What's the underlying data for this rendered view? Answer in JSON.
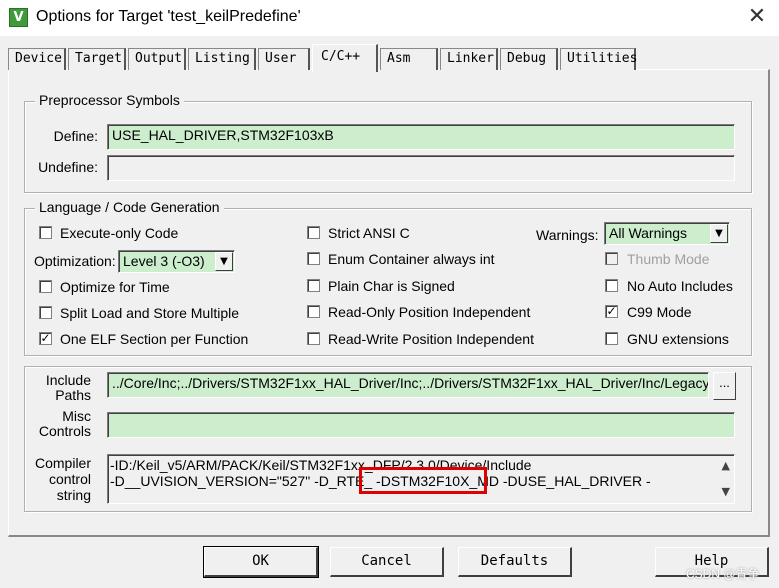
{
  "window": {
    "title": "Options for Target 'test_keilPredefine'",
    "icon": "keil-app-icon",
    "icon_glyph": "V",
    "close_glyph": "✕"
  },
  "tabs": [
    {
      "label": "Device"
    },
    {
      "label": "Target"
    },
    {
      "label": "Output"
    },
    {
      "label": "Listing"
    },
    {
      "label": "User"
    },
    {
      "label": "C/C++"
    },
    {
      "label": "Asm"
    },
    {
      "label": "Linker"
    },
    {
      "label": "Debug"
    },
    {
      "label": "Utilities"
    }
  ],
  "active_tab": "C/C++",
  "preprocessor": {
    "title": "Preprocessor Symbols",
    "define_label": "Define:",
    "define_value": "USE_HAL_DRIVER,STM32F103xB",
    "undefine_label": "Undefine:",
    "undefine_value": ""
  },
  "codegen": {
    "title": "Language / Code Generation",
    "execute_only": {
      "label": "Execute-only Code",
      "checked": false,
      "mark": ""
    },
    "optimization_label": "Optimization:",
    "optimization_value": "Level 3 (-O3)",
    "optimize_time": {
      "label": "Optimize for Time",
      "checked": false,
      "mark": ""
    },
    "split_load": {
      "label": "Split Load and Store Multiple",
      "checked": false,
      "mark": ""
    },
    "one_elf": {
      "label": "One ELF Section per Function",
      "checked": true,
      "mark": "✓"
    },
    "strict_ansi": {
      "label": "Strict ANSI C",
      "checked": false,
      "mark": ""
    },
    "enum_int": {
      "label": "Enum Container always int",
      "checked": false,
      "mark": ""
    },
    "plain_char": {
      "label": "Plain Char is Signed",
      "checked": false,
      "mark": ""
    },
    "ro_pi": {
      "label": "Read-Only Position Independent",
      "checked": false,
      "mark": ""
    },
    "rw_pi": {
      "label": "Read-Write Position Independent",
      "checked": false,
      "mark": ""
    },
    "warnings_label": "Warnings:",
    "warnings_value": "All Warnings",
    "thumb_mode": {
      "label": "Thumb Mode",
      "checked": false,
      "mark": "",
      "disabled": true
    },
    "no_auto_includes": {
      "label": "No Auto Includes",
      "checked": false,
      "mark": ""
    },
    "c99_mode": {
      "label": "C99 Mode",
      "checked": true,
      "mark": "✓"
    },
    "gnu_ext": {
      "label": "GNU extensions",
      "checked": false,
      "mark": ""
    }
  },
  "misc": {
    "include_label_1": "Include",
    "include_label_2": "Paths",
    "include_value": "../Core/Inc;../Drivers/STM32F1xx_HAL_Driver/Inc;../Drivers/STM32F1xx_HAL_Driver/Inc/Legacy;",
    "browse_label": "...",
    "misc_label_1": "Misc",
    "misc_label_2": "Controls",
    "misc_value": "",
    "compiler_label_1": "Compiler",
    "compiler_label_2": "control",
    "compiler_label_3": "string",
    "compiler_line_1": "-ID:/Keil_v5/ARM/PACK/Keil/STM32F1xx_DFP/2.3.0/Device/Include",
    "compiler_line_2": "-D__UVISION_VERSION=\"527\" -D_RTE_ -DSTM32F10X_MD -DUSE_HAL_DRIVER -",
    "highlight_color": "#e00000"
  },
  "buttons": {
    "ok": "OK",
    "cancel": "Cancel",
    "defaults": "Defaults",
    "help": "Help"
  },
  "watermark": "CSDN @青争",
  "colors": {
    "field_green": "#cdeecd",
    "dialog_bg": "#f0f0f0"
  }
}
